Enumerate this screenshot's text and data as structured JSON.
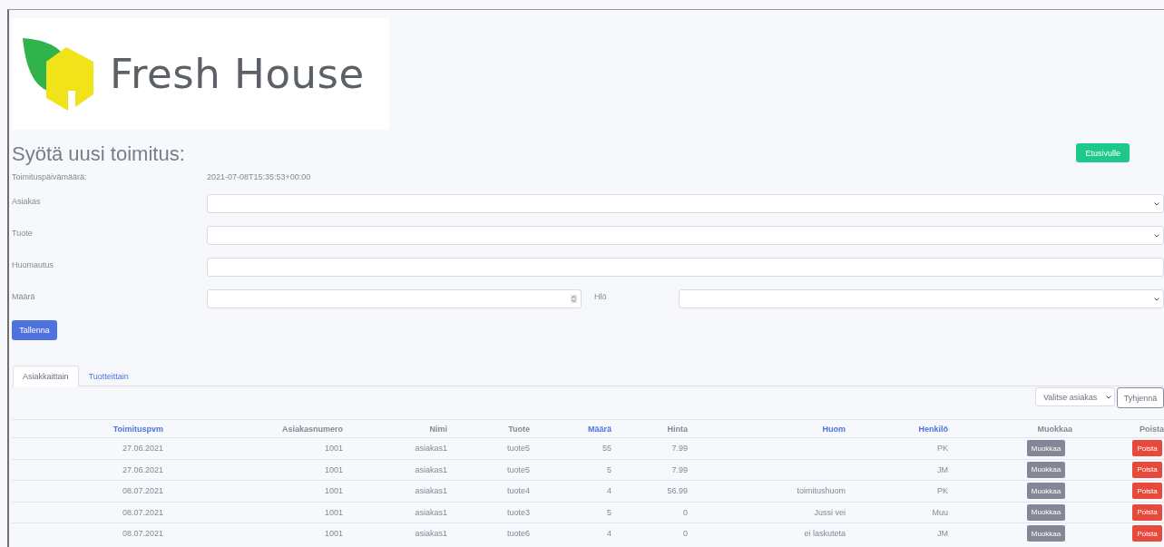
{
  "logo": {
    "text": "Fresh House"
  },
  "form": {
    "title": "Syötä uusi toimitus:",
    "home_button": "Etusivulle",
    "date": {
      "label": "Toimituspäivämäärä:",
      "value": "2021-07-08T15:35:53+00:00"
    },
    "fields": [
      {
        "label": "Asiakas",
        "kind": "select"
      },
      {
        "label": "Tuote",
        "kind": "select"
      },
      {
        "label": "Huomautus",
        "kind": "text"
      }
    ],
    "quantity": {
      "label": "Määrä"
    },
    "person": {
      "label": "Hlö"
    },
    "save_button": "Tallenna"
  },
  "tabs": [
    {
      "label": "Asiakkaittain",
      "selected": true
    },
    {
      "label": "Tuotteittain",
      "selected": false
    }
  ],
  "filter": {
    "select": "Valitse asiakas",
    "clear_button": "Tyhjennä"
  },
  "table": {
    "columns": [
      {
        "label": "Toimituspvm",
        "sortable": true
      },
      {
        "label": "Asiakasnumero",
        "sortable": false
      },
      {
        "label": "Nimi",
        "sortable": false
      },
      {
        "label": "Tuote",
        "sortable": false
      },
      {
        "label": "Määrä",
        "sortable": true
      },
      {
        "label": "Hinta",
        "sortable": false
      },
      {
        "label": "Huom",
        "sortable": true
      },
      {
        "label": "Henkilö",
        "sortable": true
      },
      {
        "label": "Muokkaa",
        "sortable": false
      },
      {
        "label": "Poista",
        "sortable": false
      }
    ],
    "rows": [
      {
        "date": "27.06.2021",
        "customer_no": "1001",
        "name": "asiakas1",
        "product": "tuote5",
        "quantity": "55",
        "price": "7.99",
        "note": "",
        "person": "PK",
        "edit": "Muokkaa",
        "delete": "Poista"
      },
      {
        "date": "27.06.2021",
        "customer_no": "1001",
        "name": "asiakas1",
        "product": "tuote5",
        "quantity": "5",
        "price": "7.99",
        "note": "",
        "person": "JM",
        "edit": "Muokkaa",
        "delete": "Poista"
      },
      {
        "date": "08.07.2021",
        "customer_no": "1001",
        "name": "asiakas1",
        "product": "tuote4",
        "quantity": "4",
        "price": "56.99",
        "note": "toimitushuom",
        "person": "PK",
        "edit": "Muokkaa",
        "delete": "Poista"
      },
      {
        "date": "08.07.2021",
        "customer_no": "1001",
        "name": "asiakas1",
        "product": "tuote3",
        "quantity": "5",
        "price": "0",
        "note": "Jussi vei",
        "person": "Muu",
        "edit": "Muokkaa",
        "delete": "Poista"
      },
      {
        "date": "08.07.2021",
        "customer_no": "1001",
        "name": "asiakas1",
        "product": "tuote6",
        "quantity": "4",
        "price": "0",
        "note": "ei laskuteta",
        "person": "JM",
        "edit": "Muokkaa",
        "delete": "Poista"
      }
    ]
  }
}
